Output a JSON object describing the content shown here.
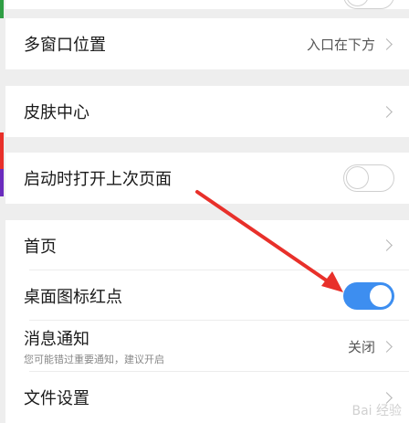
{
  "settings": {
    "multi_window": {
      "label": "多窗口位置",
      "value": "入口在下方"
    },
    "skin_center": {
      "label": "皮肤中心"
    },
    "restore_last_page": {
      "label": "启动时打开上次页面",
      "enabled": false
    },
    "home_page": {
      "label": "首页"
    },
    "icon_badge": {
      "label": "桌面图标红点",
      "enabled": true
    },
    "notifications": {
      "label": "消息通知",
      "subtitle": "您可能错过重要通知，建议开启",
      "value": "关闭"
    },
    "file_settings": {
      "label": "文件设置"
    }
  },
  "colors": {
    "toggle_on": "#3d8ef0",
    "annotation_arrow": "#e8302a",
    "background": "#eeeeee"
  },
  "watermark": {
    "text": "Bai 经验"
  }
}
